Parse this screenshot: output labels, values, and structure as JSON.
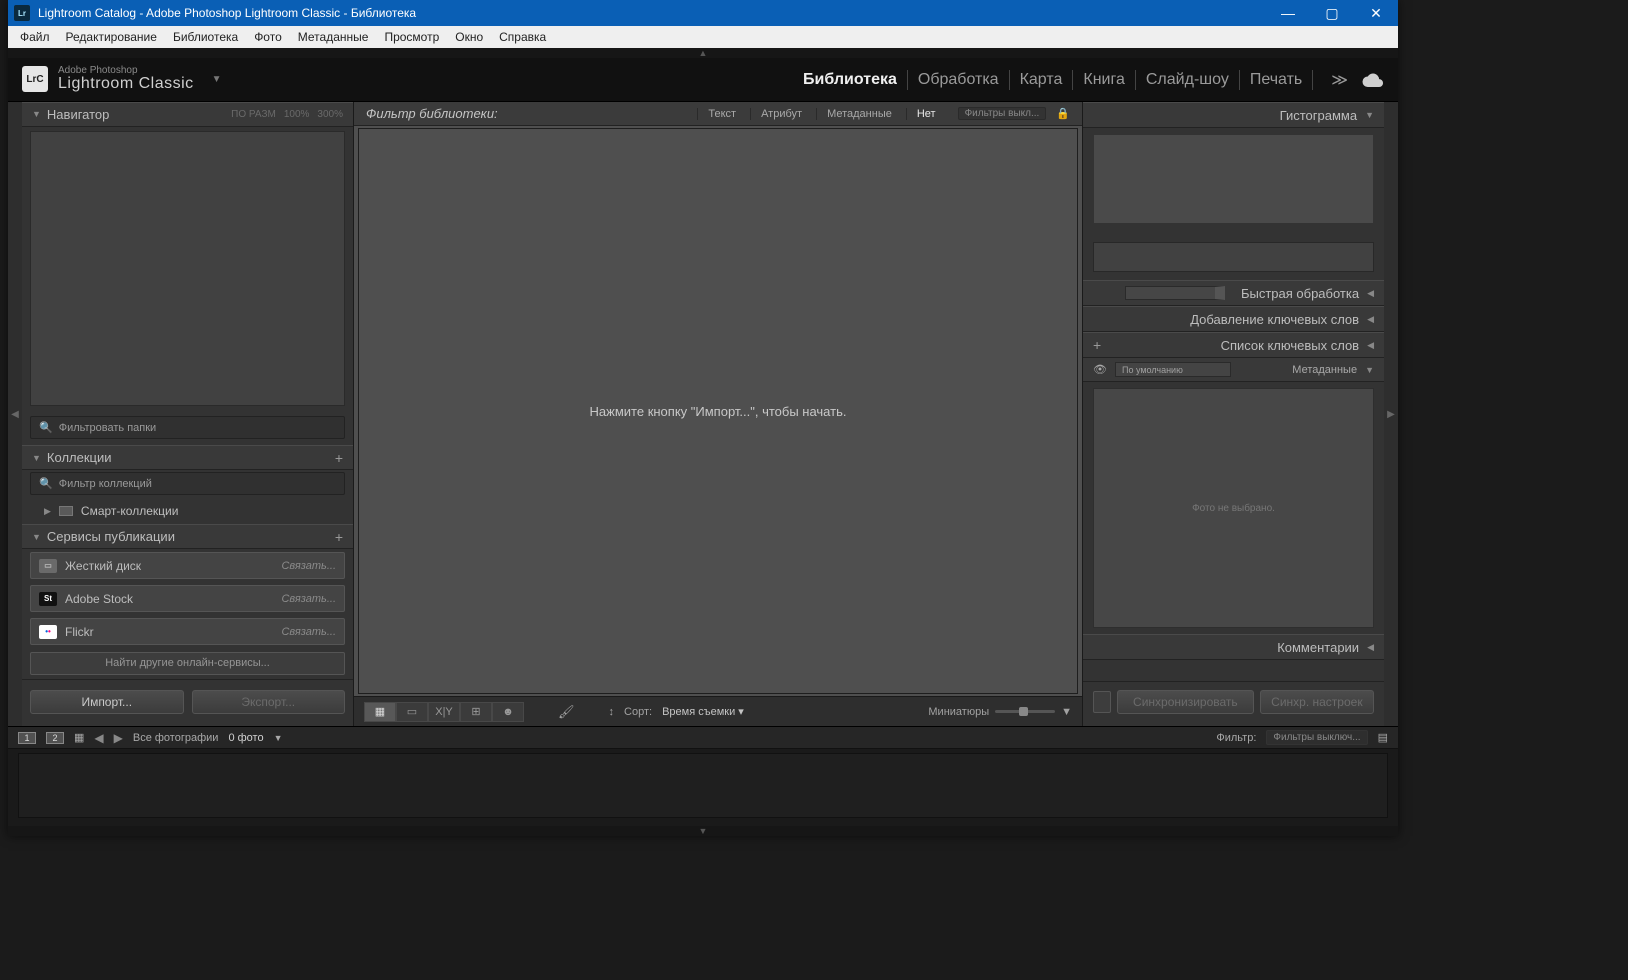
{
  "titlebar": {
    "app_badge": "Lr",
    "title": "Lightroom Catalog - Adobe Photoshop Lightroom Classic - Библиотека"
  },
  "menubar": [
    "Файл",
    "Редактирование",
    "Библиотека",
    "Фото",
    "Метаданные",
    "Просмотр",
    "Окно",
    "Справка"
  ],
  "brand": {
    "badge": "LrC",
    "sup": "Adobe Photoshop",
    "main": "Lightroom Classic"
  },
  "modules": [
    "Библиотека",
    "Обработка",
    "Карта",
    "Книга",
    "Слайд-шоу",
    "Печать"
  ],
  "left": {
    "navigator": {
      "title": "Навигатор",
      "fit": "ПО РАЗМ",
      "z100": "100%",
      "z300": "300%"
    },
    "folder_filter_placeholder": "Фильтровать папки",
    "collections": {
      "title": "Коллекции",
      "filter_placeholder": "Фильтр коллекций",
      "smart": "Смарт-коллекции"
    },
    "publish": {
      "title": "Сервисы публикации",
      "items": [
        {
          "name": "Жесткий диск",
          "setup": "Связать..."
        },
        {
          "name": "Adobe Stock",
          "setup": "Связать..."
        },
        {
          "name": "Flickr",
          "setup": "Связать..."
        }
      ],
      "find_more": "Найти другие онлайн-сервисы..."
    },
    "import_btn": "Импорт...",
    "export_btn": "Экспорт..."
  },
  "center": {
    "filter_label": "Фильтр библиотеки:",
    "filters": [
      "Текст",
      "Атрибут",
      "Метаданные",
      "Нет"
    ],
    "filter_preset": "Фильтры выкл...",
    "empty_msg": "Нажмите кнопку \"Импорт...\", чтобы начать.",
    "toolbar": {
      "sort_label": "Сорт:",
      "sort_value": "Время съемки",
      "thumbs": "Миниатюры"
    }
  },
  "right": {
    "histogram": "Гистограмма",
    "quick_dev": "Быстрая обработка",
    "keywording": "Добавление ключевых слов",
    "keyword_list": "Список ключевых слов",
    "metadata": "Метаданные",
    "metadata_preset": "По умолчанию",
    "metadata_empty": "Фото не выбрано.",
    "comments": "Комментарии",
    "sync_btn": "Синхронизировать",
    "sync_settings_btn": "Синхр. настроек"
  },
  "filmstrip": {
    "screens": [
      "1",
      "2"
    ],
    "breadcrumb": "Все фотографии",
    "count": "0 фото",
    "filter_label": "Фильтр:",
    "filter_preset": "Фильтры выключ..."
  }
}
